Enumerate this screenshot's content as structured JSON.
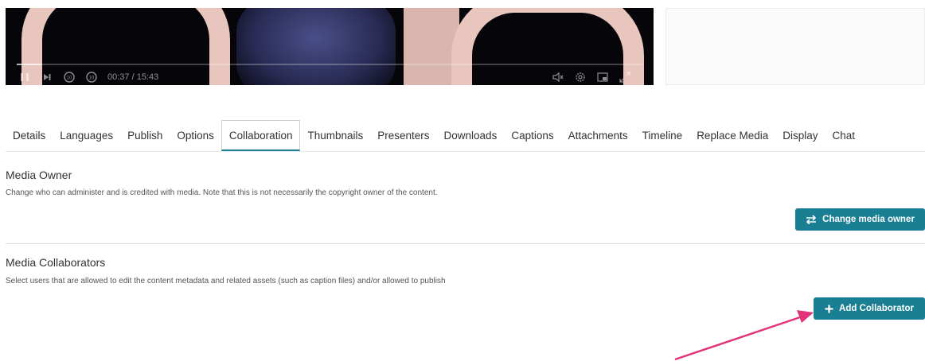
{
  "player": {
    "time": "00:37 / 15:43",
    "progress_fraction": 0.04
  },
  "tabs": [
    {
      "label": "Details"
    },
    {
      "label": "Languages"
    },
    {
      "label": "Publish"
    },
    {
      "label": "Options"
    },
    {
      "label": "Collaboration",
      "active": true
    },
    {
      "label": "Thumbnails"
    },
    {
      "label": "Presenters"
    },
    {
      "label": "Downloads"
    },
    {
      "label": "Captions"
    },
    {
      "label": "Attachments"
    },
    {
      "label": "Timeline"
    },
    {
      "label": "Replace Media"
    },
    {
      "label": "Display"
    },
    {
      "label": "Chat"
    }
  ],
  "owner": {
    "title": "Media Owner",
    "description": "Change who can administer and is credited with media. Note that this is not necessarily the copyright owner of the content.",
    "button_label": "Change media owner",
    "button_icon": "swap-arrows-icon"
  },
  "collaborators": {
    "title": "Media Collaborators",
    "description": "Select users that are allowed to edit the content metadata and related assets (such as caption files) and/or allowed to publish",
    "button_label": "Add Collaborator",
    "button_icon": "plus-icon"
  },
  "colors": {
    "accent": "#1a7f92",
    "annotation_arrow": "#e0337a"
  }
}
